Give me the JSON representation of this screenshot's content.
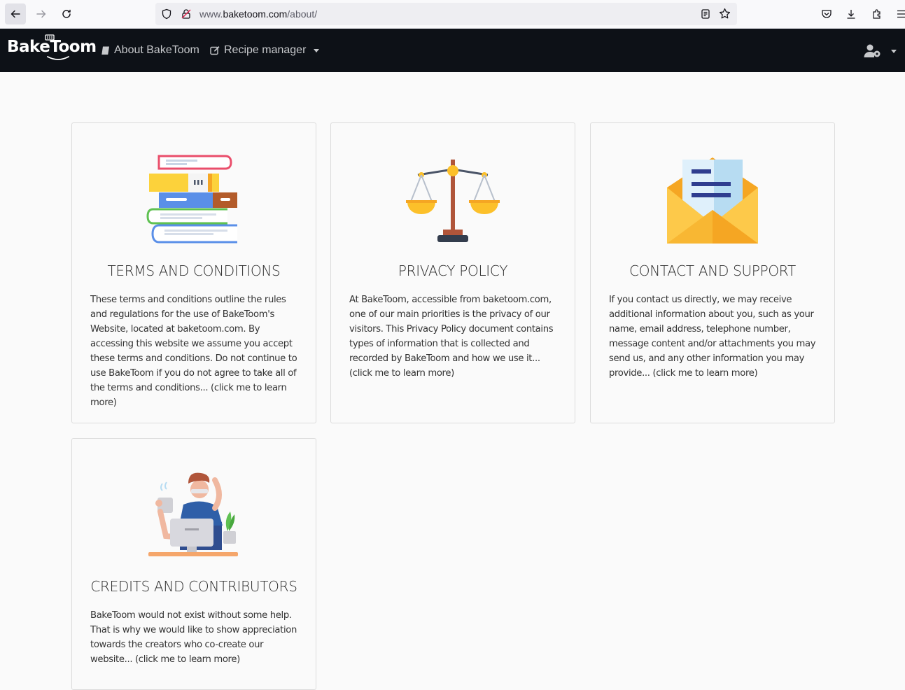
{
  "browser": {
    "url_prefix": "www.",
    "url_domain": "baketoom.com",
    "url_path": "/about/"
  },
  "nav": {
    "brand": "BakeToom",
    "about_label": "About BakeToom",
    "recipe_label": "Recipe manager"
  },
  "cards": [
    {
      "title": "TERMS AND CONDITIONS",
      "text": "These terms and conditions outline the rules and regulations for the use of BakeToom's Website, located at baketoom.com. By accessing this website we assume you accept these terms and conditions. Do not continue to use BakeToom if you do not agree to take all of the terms and conditions... (click me to learn more)",
      "icon": "books-icon"
    },
    {
      "title": "PRIVACY POLICY",
      "text": "At BakeToom, accessible from baketoom.com, one of our main priorities is the privacy of our visitors. This Privacy Policy document contains types of information that is collected and recorded by BakeToom and how we use it... (click me to learn more)",
      "icon": "scales-icon"
    },
    {
      "title": "CONTACT AND SUPPORT",
      "text": "If you contact us directly, we may receive additional information about you, such as your name, email address, telephone number, message content and/or attachments you may send us, and any other information you may provide... (click me to learn more)",
      "icon": "envelope-icon"
    },
    {
      "title": "CREDITS AND CONTRIBUTORS",
      "text": "BakeToom would not exist without some help. That is why we would like to show appreciation towards the creators who co-create our website... (click me to learn more)",
      "icon": "developer-icon"
    }
  ]
}
